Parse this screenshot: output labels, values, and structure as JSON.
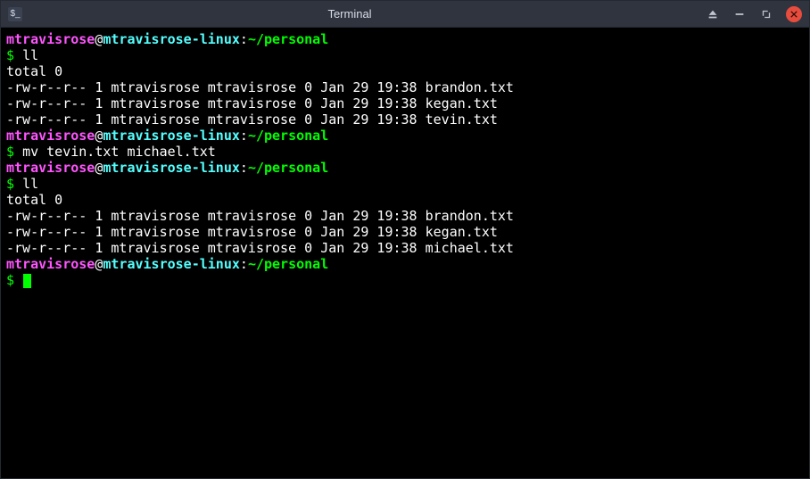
{
  "window": {
    "title": "Terminal",
    "app_icon_glyph": "$_"
  },
  "prompt": {
    "user": "mtravisrose",
    "at": "@",
    "host": "mtravisrose-linux",
    "colon": ":",
    "path": "~/personal",
    "symbol": "$"
  },
  "session": [
    {
      "type": "prompt_cmd",
      "cmd": "ll"
    },
    {
      "type": "output",
      "text": "total 0"
    },
    {
      "type": "output",
      "text": "-rw-r--r-- 1 mtravisrose mtravisrose 0 Jan 29 19:38 brandon.txt"
    },
    {
      "type": "output",
      "text": "-rw-r--r-- 1 mtravisrose mtravisrose 0 Jan 29 19:38 kegan.txt"
    },
    {
      "type": "output",
      "text": "-rw-r--r-- 1 mtravisrose mtravisrose 0 Jan 29 19:38 tevin.txt"
    },
    {
      "type": "prompt_cmd",
      "cmd": "mv tevin.txt michael.txt"
    },
    {
      "type": "prompt_cmd",
      "cmd": "ll"
    },
    {
      "type": "output",
      "text": "total 0"
    },
    {
      "type": "output",
      "text": "-rw-r--r-- 1 mtravisrose mtravisrose 0 Jan 29 19:38 brandon.txt"
    },
    {
      "type": "output",
      "text": "-rw-r--r-- 1 mtravisrose mtravisrose 0 Jan 29 19:38 kegan.txt"
    },
    {
      "type": "output",
      "text": "-rw-r--r-- 1 mtravisrose mtravisrose 0 Jan 29 19:38 michael.txt"
    },
    {
      "type": "prompt_cursor"
    }
  ]
}
